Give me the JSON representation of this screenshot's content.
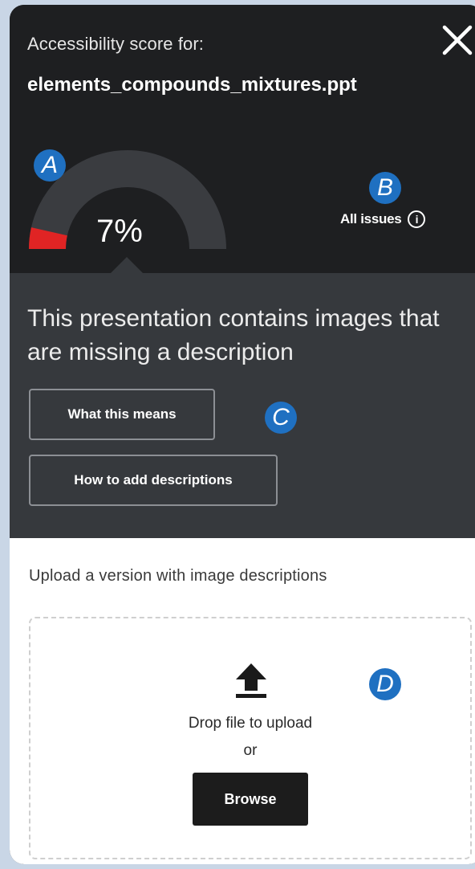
{
  "header": {
    "caption": "Accessibility score for:",
    "filename": "elements_compounds_mixtures.ppt",
    "close_icon": "close-icon"
  },
  "score": {
    "value_label": "7%",
    "value": 0.07,
    "track_color": "#3a3c40",
    "fill_color": "#e02424"
  },
  "markers": {
    "a": "A",
    "b": "B",
    "c": "C",
    "d": "D",
    "color": "#1f70c1"
  },
  "issues": {
    "link_label": "All issues",
    "icon": "info-icon",
    "icon_glyph": "i"
  },
  "message": {
    "text": "This presentation contains images that are missing a description",
    "what_label": "What this means",
    "how_label": "How to add descriptions"
  },
  "upload": {
    "title": "Upload a version with image descriptions",
    "icon": "upload-icon",
    "drop_text": "Drop file to upload",
    "or_text": "or",
    "browse_label": "Browse"
  }
}
